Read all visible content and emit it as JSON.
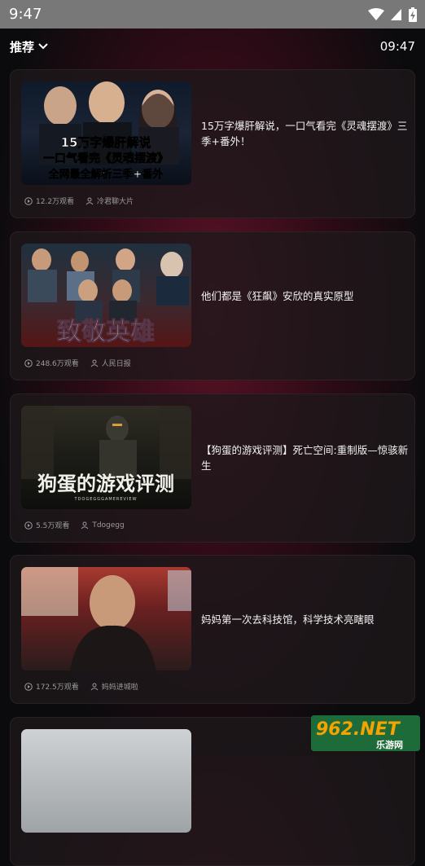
{
  "status_bar": {
    "time": "9:47"
  },
  "header": {
    "tab_label": "推荐",
    "clock": "09:47"
  },
  "videos": [
    {
      "title": "15万字爆肝解说，一口气看完《灵魂摆渡》三季+番外！",
      "views": "12.2万观看",
      "author": "冷君聊大片",
      "thumb_text": [
        "15万字爆肝解说",
        "一口气看完《灵魂摆渡》",
        "全网最全解析三季+番外"
      ]
    },
    {
      "title": "他们都是《狂飙》安欣的真实原型",
      "views": "248.6万观看",
      "author": "人民日报",
      "thumb_text": [
        "致敬英雄"
      ]
    },
    {
      "title": "【狗蛋的游戏评测】死亡空间:重制版—惊骇新生",
      "views": "5.5万观看",
      "author": "Tdogegg",
      "thumb_text": [
        "狗蛋的游戏评测",
        "TDOGEGGGAMEREVIEW"
      ]
    },
    {
      "title": "妈妈第一次去科技馆，科学技术亮瞎眼",
      "views": "172.5万观看",
      "author": "妈妈进城啦",
      "thumb_text": []
    }
  ],
  "watermark": {
    "brand": "962.NET",
    "sub": "乐游网"
  },
  "icons": {
    "wifi": "wifi-icon",
    "signal": "signal-icon",
    "battery": "battery-icon",
    "dropdown": "chevron-down-icon",
    "views": "play-circle-icon",
    "author": "user-icon"
  }
}
